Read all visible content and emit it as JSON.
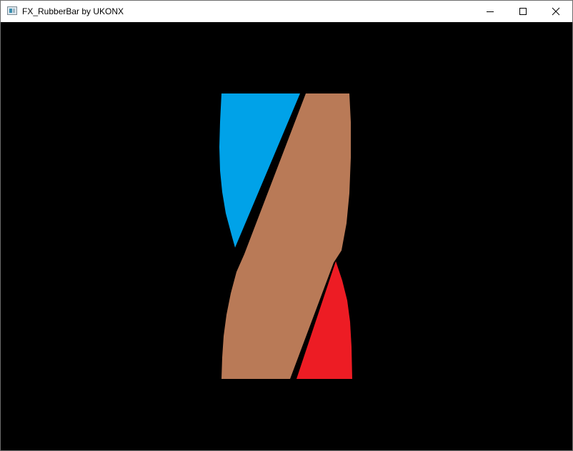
{
  "window": {
    "title": "FX_RubberBar by UKONX",
    "icon": "application-window-icon",
    "controls": {
      "minimize": "minimize-icon",
      "maximize": "maximize-icon",
      "close": "close-icon"
    }
  },
  "canvas": {
    "background": "#000000",
    "shapes": [
      {
        "name": "blue-shape",
        "color": "#00a2e8"
      },
      {
        "name": "brown-band",
        "color": "#b97a57"
      },
      {
        "name": "red-shape",
        "color": "#ed1c24"
      }
    ]
  }
}
